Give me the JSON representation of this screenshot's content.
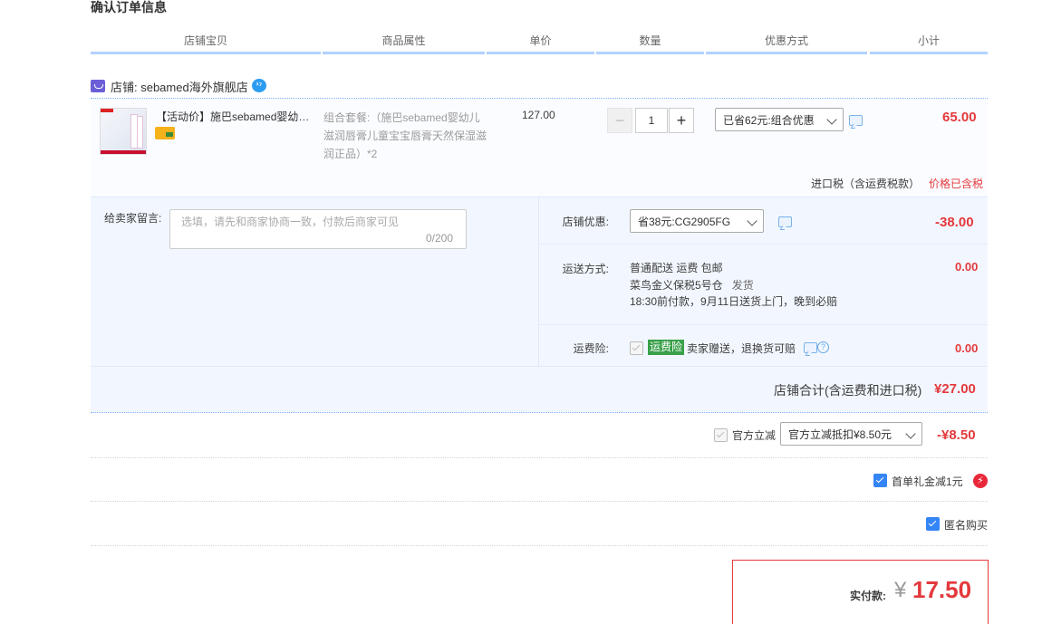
{
  "page_title": "确认订单信息",
  "columns": [
    "店铺宝贝",
    "商品属性",
    "单价",
    "数量",
    "优惠方式",
    "小计"
  ],
  "shop": {
    "label": "店铺: sebamed海外旗舰店"
  },
  "item": {
    "name": "【活动价】施巴sebamed婴幼…",
    "props": "组合套餐:（施巴sebamed婴幼儿滋润唇膏儿童宝宝唇膏天然保湿滋润正品）*2",
    "unit_price": "127.00",
    "quantity": "1",
    "qty_minus": "−",
    "qty_plus": "+",
    "discount": "已省62元:组合优惠",
    "subtotal": "65.00",
    "tax_label": "进口税（含运费税款）",
    "tax_value": "价格已含税"
  },
  "message": {
    "label": "给卖家留言:",
    "placeholder": "选填，请先和商家协商一致，付款后商家可见",
    "count": "0/200"
  },
  "shop_discount": {
    "label": "店铺优惠:",
    "value": "省38元:CG2905FG",
    "amount": "-38.00"
  },
  "shipping": {
    "label": "运送方式:",
    "line1": "普通配送 运费 包邮",
    "line2_a": "菜鸟金义保税5号仓",
    "line2_b": "发货",
    "line3": "18:30前付款，9月11日送货上门，晚到必赔",
    "amount": "0.00"
  },
  "insurance": {
    "label": "运费险:",
    "tag": "运费险",
    "text": "卖家赠送，退换货可赔",
    "amount": "0.00"
  },
  "shop_total": {
    "label": "店铺合计(含运费和进口税)",
    "amount": "¥27.00"
  },
  "official": {
    "label": "官方立减",
    "select": "官方立减抵扣¥8.50元",
    "amount": "-¥8.50"
  },
  "first_order": {
    "label": "首单礼金减1元",
    "bolt": "⚡"
  },
  "anonymous": {
    "label": "匿名购买"
  },
  "pay": {
    "label": "实付款:",
    "symbol": "¥",
    "amount": "17.50"
  }
}
